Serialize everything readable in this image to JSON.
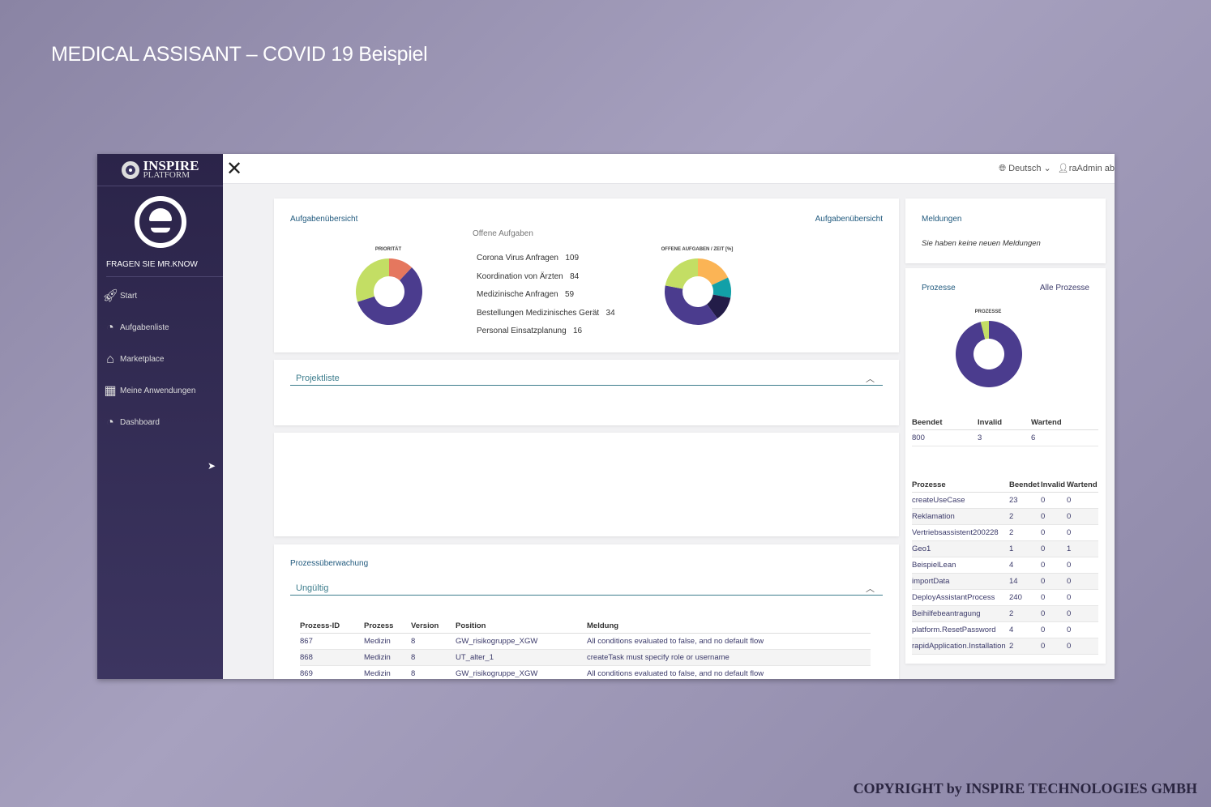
{
  "slide_title": "MEDICAL ASSISANT – COVID 19 Beispiel",
  "copyright": "COPYRIGHT by INSPIRE TECHNOLOGIES GMBH",
  "logo": {
    "line1": "INSPIRE",
    "line2": "PLATFORM"
  },
  "sidebar": {
    "ask": "FRAGEN SIE MR.KNOW",
    "items": [
      {
        "label": "Start",
        "icon": "rocket-icon"
      },
      {
        "label": "Aufgabenliste",
        "icon": "gauge-icon"
      },
      {
        "label": "Marketplace",
        "icon": "store-icon"
      },
      {
        "label": "Meine Anwendungen",
        "icon": "grid-icon"
      },
      {
        "label": "Dashboard",
        "icon": "gauge-icon"
      }
    ]
  },
  "topbar": {
    "language": "Deutsch",
    "user": "raAdmin ab"
  },
  "overview": {
    "title": "Aufgabenübersicht",
    "title_right": "Aufgabenübersicht",
    "open_tasks": "Offene Aufgaben",
    "list": [
      {
        "name": "Corona Virus Anfragen",
        "count": "109"
      },
      {
        "name": "Koordination von Ärzten",
        "count": "84"
      },
      {
        "name": "Medizinische Anfragen",
        "count": "59"
      },
      {
        "name": "Bestellungen Medizinisches Gerät",
        "count": "34"
      },
      {
        "name": "Personal Einsatzplanung",
        "count": "16"
      }
    ]
  },
  "chart_data": [
    {
      "type": "pie",
      "title": "PRIORITÄT",
      "values": [
        12,
        58,
        30
      ],
      "colors": [
        "#e5775e",
        "#4b3c8e",
        "#c3de64"
      ]
    },
    {
      "type": "pie",
      "title": "OFFENE AUFGABEN / ZEIT [%]",
      "values": [
        18,
        10,
        12,
        38,
        22
      ],
      "colors": [
        "#fbb455",
        "#12a0a8",
        "#231c48",
        "#4b3c8e",
        "#c3de64"
      ]
    },
    {
      "type": "pie",
      "title": "PROZESSE",
      "values": [
        96,
        4
      ],
      "colors": [
        "#4b3c8e",
        "#c3de64"
      ]
    }
  ],
  "projektliste": "Projektliste",
  "monitoring": {
    "title": "Prozessüberwachung",
    "section": "Ungültig",
    "headers": [
      "Prozess-ID",
      "Prozess",
      "Version",
      "Position",
      "Meldung"
    ],
    "rows": [
      [
        "867",
        "Medizin",
        "8",
        "GW_risikogruppe_XGW",
        "All conditions evaluated to false, and no default flow"
      ],
      [
        "868",
        "Medizin",
        "8",
        "UT_alter_1",
        "createTask must specify role or username"
      ],
      [
        "869",
        "Medizin",
        "8",
        "GW_risikogruppe_XGW",
        "All conditions evaluated to false, and no default flow"
      ]
    ]
  },
  "messages": {
    "title": "Meldungen",
    "text": "Sie haben keine neuen Meldungen"
  },
  "processes": {
    "title": "Prozesse",
    "all_link": "Alle Prozesse",
    "summary_headers": [
      "Beendet",
      "Invalid",
      "Wartend"
    ],
    "summary": [
      "800",
      "3",
      "6"
    ],
    "headers": [
      "Prozesse",
      "Beendet",
      "Invalid",
      "Wartend"
    ],
    "rows": [
      [
        "createUseCase",
        "23",
        "0",
        "0"
      ],
      [
        "Reklamation",
        "2",
        "0",
        "0"
      ],
      [
        "Vertriebsassistent200228",
        "2",
        "0",
        "0"
      ],
      [
        "Geo1",
        "1",
        "0",
        "1"
      ],
      [
        "BeispielLean",
        "4",
        "0",
        "0"
      ],
      [
        "importData",
        "14",
        "0",
        "0"
      ],
      [
        "DeployAssistantProcess",
        "240",
        "0",
        "0"
      ],
      [
        "Beihilfebeantragung",
        "2",
        "0",
        "0"
      ],
      [
        "platform.ResetPassword",
        "4",
        "0",
        "0"
      ],
      [
        "rapidApplication.Installation",
        "2",
        "0",
        "0"
      ]
    ]
  }
}
